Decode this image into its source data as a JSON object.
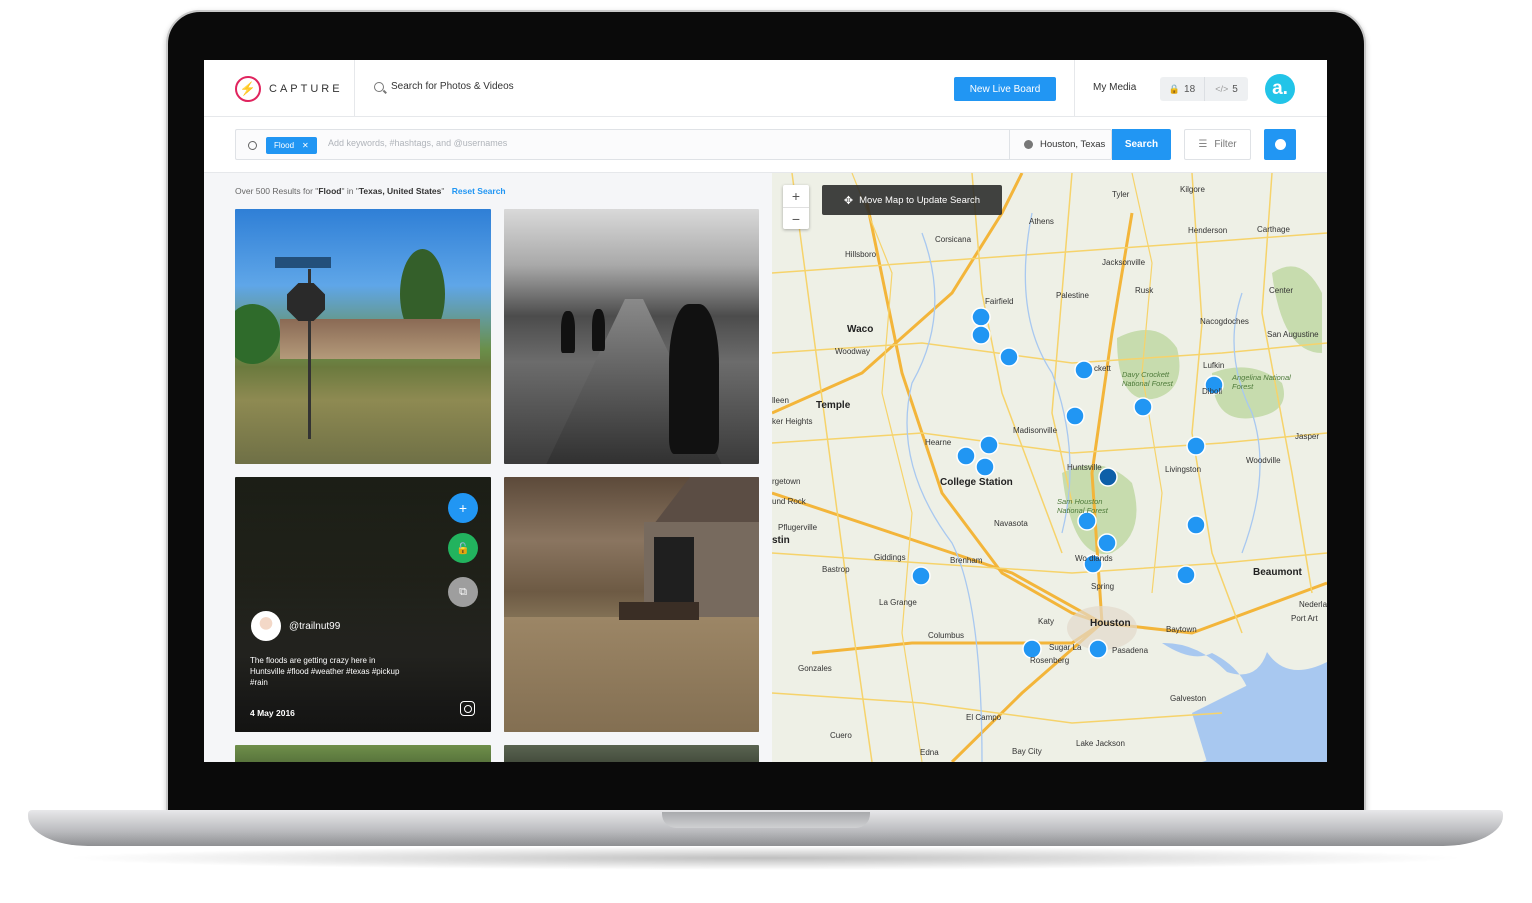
{
  "app": {
    "logo_text": "CAPTURE",
    "top_search_label": "Search for Photos & Videos",
    "new_live_board": "New Live Board",
    "my_media": "My Media",
    "counter_locked": "18",
    "counter_embed": "5",
    "avatar_letter": "a."
  },
  "search": {
    "tag": "Flood",
    "placeholder": "Add keywords, #hashtags, and @usernames",
    "location": "Houston, Texas",
    "search_button": "Search",
    "filter_button": "Filter"
  },
  "results": {
    "prefix": "Over 500 Results for \"",
    "term": "Flood",
    "mid": "\" in \"",
    "place": "Texas, United States",
    "suffix": "\"",
    "reset": "Reset Search"
  },
  "post": {
    "username": "@trailnut99",
    "caption": "The floods are getting crazy here in Huntsville #flood #weather #texas #pickup #rain",
    "date": "4 May 2016"
  },
  "map": {
    "hint": "Move Map to Update Search",
    "zoom_in": "+",
    "zoom_out": "−",
    "labels": {
      "tyler": "Tyler",
      "kilgore": "Kilgore",
      "athens": "Athens",
      "corsicana": "Corsicana",
      "henderson": "Henderson",
      "carthage": "Carthage",
      "hillsboro": "Hillsboro",
      "jacksonville": "Jacksonville",
      "fairfield": "Fairfield",
      "palestine": "Palestine",
      "rusk": "Rusk",
      "center": "Center",
      "waco": "Waco",
      "woodway": "Woodway",
      "nacogdoches": "Nacogdoches",
      "san_augustine": "San Augustine",
      "crockett": "ckett",
      "davy_crockett": "Davy Crockett National Forest",
      "lufkin": "Lufkin",
      "angelina": "Angelina National Forest",
      "diboll": "Diboll",
      "temple": "Temple",
      "killeen": "lleen",
      "harker": "ker Heights",
      "madisonville": "Madisonville",
      "jasper": "Jasper",
      "hearne": "Hearne",
      "huntsville": "Huntsville",
      "livingston": "Livingston",
      "woodville": "Woodville",
      "college_station": "College Station",
      "georgetown": "rgetown",
      "round_rock": "und Rock",
      "pflugerville": "Pflugerville",
      "austin": "stin",
      "sam_houston": "Sam Houston National Forest",
      "navasota": "Navasota",
      "giddings": "Giddings",
      "brenham": "Brenham",
      "woodlands": "Wo   dlands",
      "bastrop": "Bastrop",
      "spring": "Spring",
      "beaumont": "Beaumont",
      "la_grange": "La Grange",
      "nederland": "Nederland",
      "port_arthur": "Port Art",
      "katy": "Katy",
      "houston": "Houston",
      "baytown": "Baytown",
      "columbus": "Columbus",
      "sugar_land": "Sugar La",
      "pasadena": "Pasadena",
      "rosenberg": "Rosenberg",
      "gonzales": "Gonzales",
      "galveston": "Galveston",
      "el_campo": "El Campo",
      "cuero": "Cuero",
      "lake_jackson": "Lake Jackson",
      "edna": "Edna",
      "bay_city": "Bay City"
    }
  }
}
